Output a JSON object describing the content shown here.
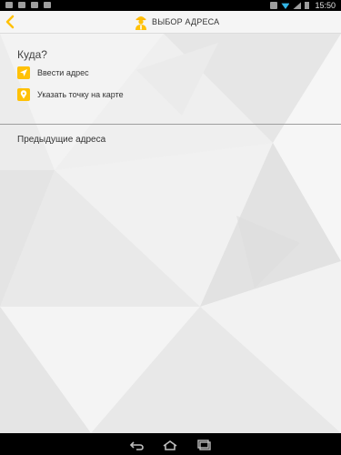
{
  "status_bar": {
    "time": "15:50",
    "left_icons": [
      "screenshot-icon",
      "gmail-icon",
      "image-icon",
      "download-icon"
    ],
    "right_icons": [
      "alarm-icon",
      "wifi-icon",
      "signal-icon",
      "battery-icon"
    ]
  },
  "header": {
    "title": "ВЫБОР АДРЕСА",
    "accent": "#ffc107"
  },
  "where": {
    "heading": "Куда?",
    "options": [
      {
        "label": "Ввести адрес",
        "icon": "navigation-arrow-icon"
      },
      {
        "label": "Указать точку на карте",
        "icon": "map-pin-icon"
      }
    ]
  },
  "previous": {
    "heading": "Предыдущие адреса"
  },
  "nav_bar": {
    "buttons": [
      "back-icon",
      "home-icon",
      "recent-apps-icon"
    ]
  }
}
